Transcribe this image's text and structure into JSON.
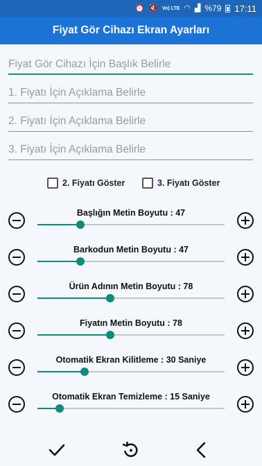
{
  "status_bar": {
    "network": "Vo) LTE",
    "battery": "%79",
    "time": "17:11"
  },
  "app_bar": {
    "title": "Fiyat Gör Cihazı Ekran Ayarları"
  },
  "fields": [
    {
      "placeholder": "Fiyat Gör Cihazı İçin Başlık Belirle"
    },
    {
      "placeholder": "1. Fiyatı İçin Açıklama Belirle"
    },
    {
      "placeholder": "2. Fiyatı İçin Açıklama Belirle"
    },
    {
      "placeholder": "3. Fiyatı İçin Açıklama Belirle"
    }
  ],
  "checkboxes": [
    {
      "label": "2. Fiyatı Göster",
      "checked": false
    },
    {
      "label": "3. Fiyatı Göster",
      "checked": false
    }
  ],
  "sliders": [
    {
      "label": "Başlığın Metin Boyutu : 47",
      "level": 0.23
    },
    {
      "label": "Barkodun Metin Boyutu : 47",
      "level": 0.23
    },
    {
      "label": "Ürün Adının Metin Boyutu : 78",
      "level": 0.39
    },
    {
      "label": "Fiyatın Metin Boyutu : 78",
      "level": 0.39
    },
    {
      "label": "Otomatik Ekran Kilitleme : 30 Saniye",
      "level": 0.25
    },
    {
      "label": "Otomatik Ekran Temizleme : 15 Saniye",
      "level": 0.12
    }
  ],
  "bottom_bar": {
    "icons": [
      "check-icon",
      "restore-icon",
      "back-chevron-icon"
    ]
  },
  "colors": {
    "status_bar": "#1f66b8",
    "app_bar": "#1d72d6",
    "accent": "#0f8a7b",
    "background": "#f4f8fd"
  }
}
